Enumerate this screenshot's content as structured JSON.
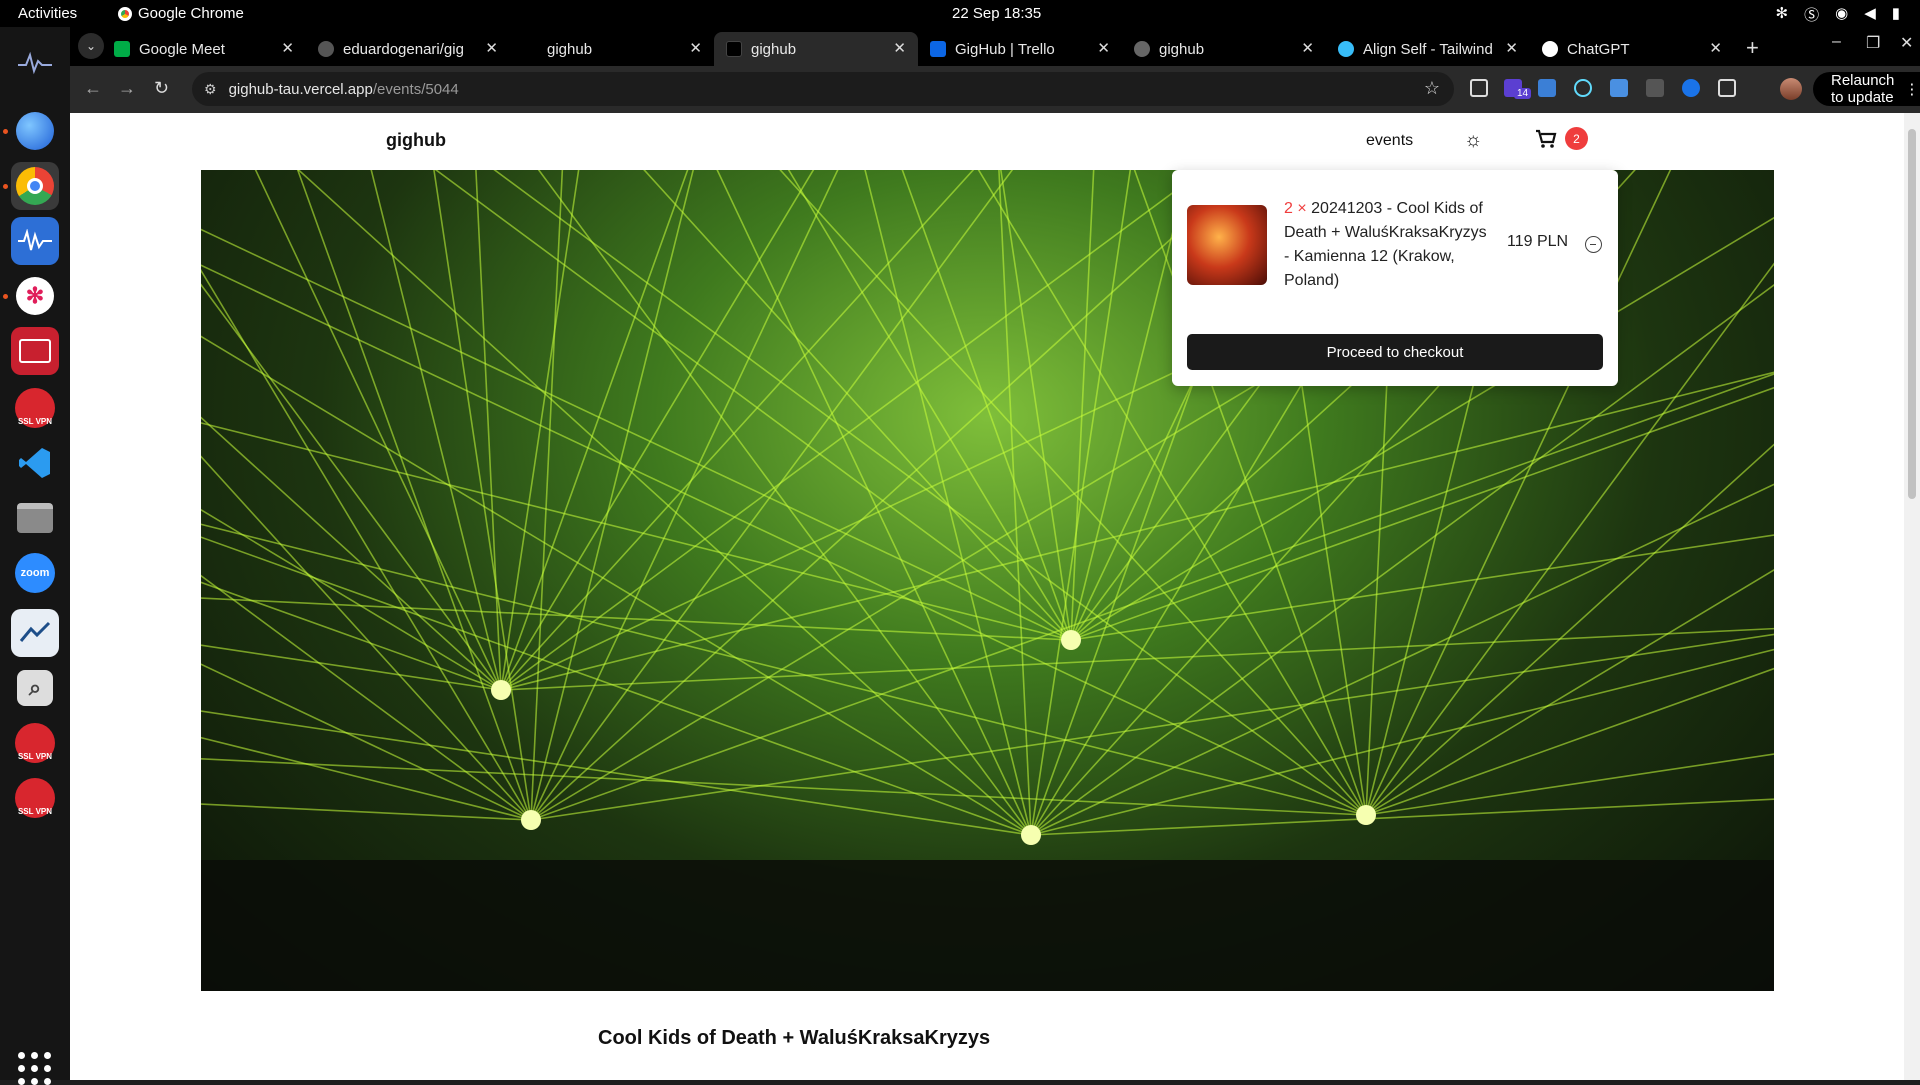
{
  "os": {
    "activities": "Activities",
    "app_name": "Google Chrome",
    "clock": "22 Sep  18:35"
  },
  "tabs": [
    {
      "title": "Google Meet",
      "color": "#1a73e8"
    },
    {
      "title": "eduardogenari/gig",
      "color": "#555555"
    },
    {
      "title": "gighub",
      "color": "#000000"
    },
    {
      "title": "gighub",
      "color": "#000000"
    },
    {
      "title": "GigHub | Trello",
      "color": "#0c66e4"
    },
    {
      "title": "gighub",
      "color": "#666666"
    },
    {
      "title": "Align Self - Tailwind",
      "color": "#38bdf8"
    },
    {
      "title": "ChatGPT",
      "color": "#ffffff"
    }
  ],
  "browser": {
    "url_host": "gighub-tau.vercel.app",
    "url_path": "/events/5044",
    "ext_badge": "14",
    "relaunch": "Relaunch to update"
  },
  "site": {
    "logo": "gighub",
    "nav_events": "events",
    "cart_count": "2",
    "event_title": "Cool Kids of Death + WaluśKraksaKryzys"
  },
  "cart": {
    "qty": "2 ×",
    "description": "20241203 - Cool Kids of Death + WaluśKraksaKryzys - Kamienna 12 (Krakow, Poland)",
    "price": "119 PLN",
    "checkout_label": "Proceed to checkout"
  },
  "dock": {
    "zoom_label": "zoom",
    "ssl_label": "SSL VPN"
  },
  "colors": {
    "accent_red": "#ef3d3d",
    "laser_green": "#c8ff3a"
  }
}
